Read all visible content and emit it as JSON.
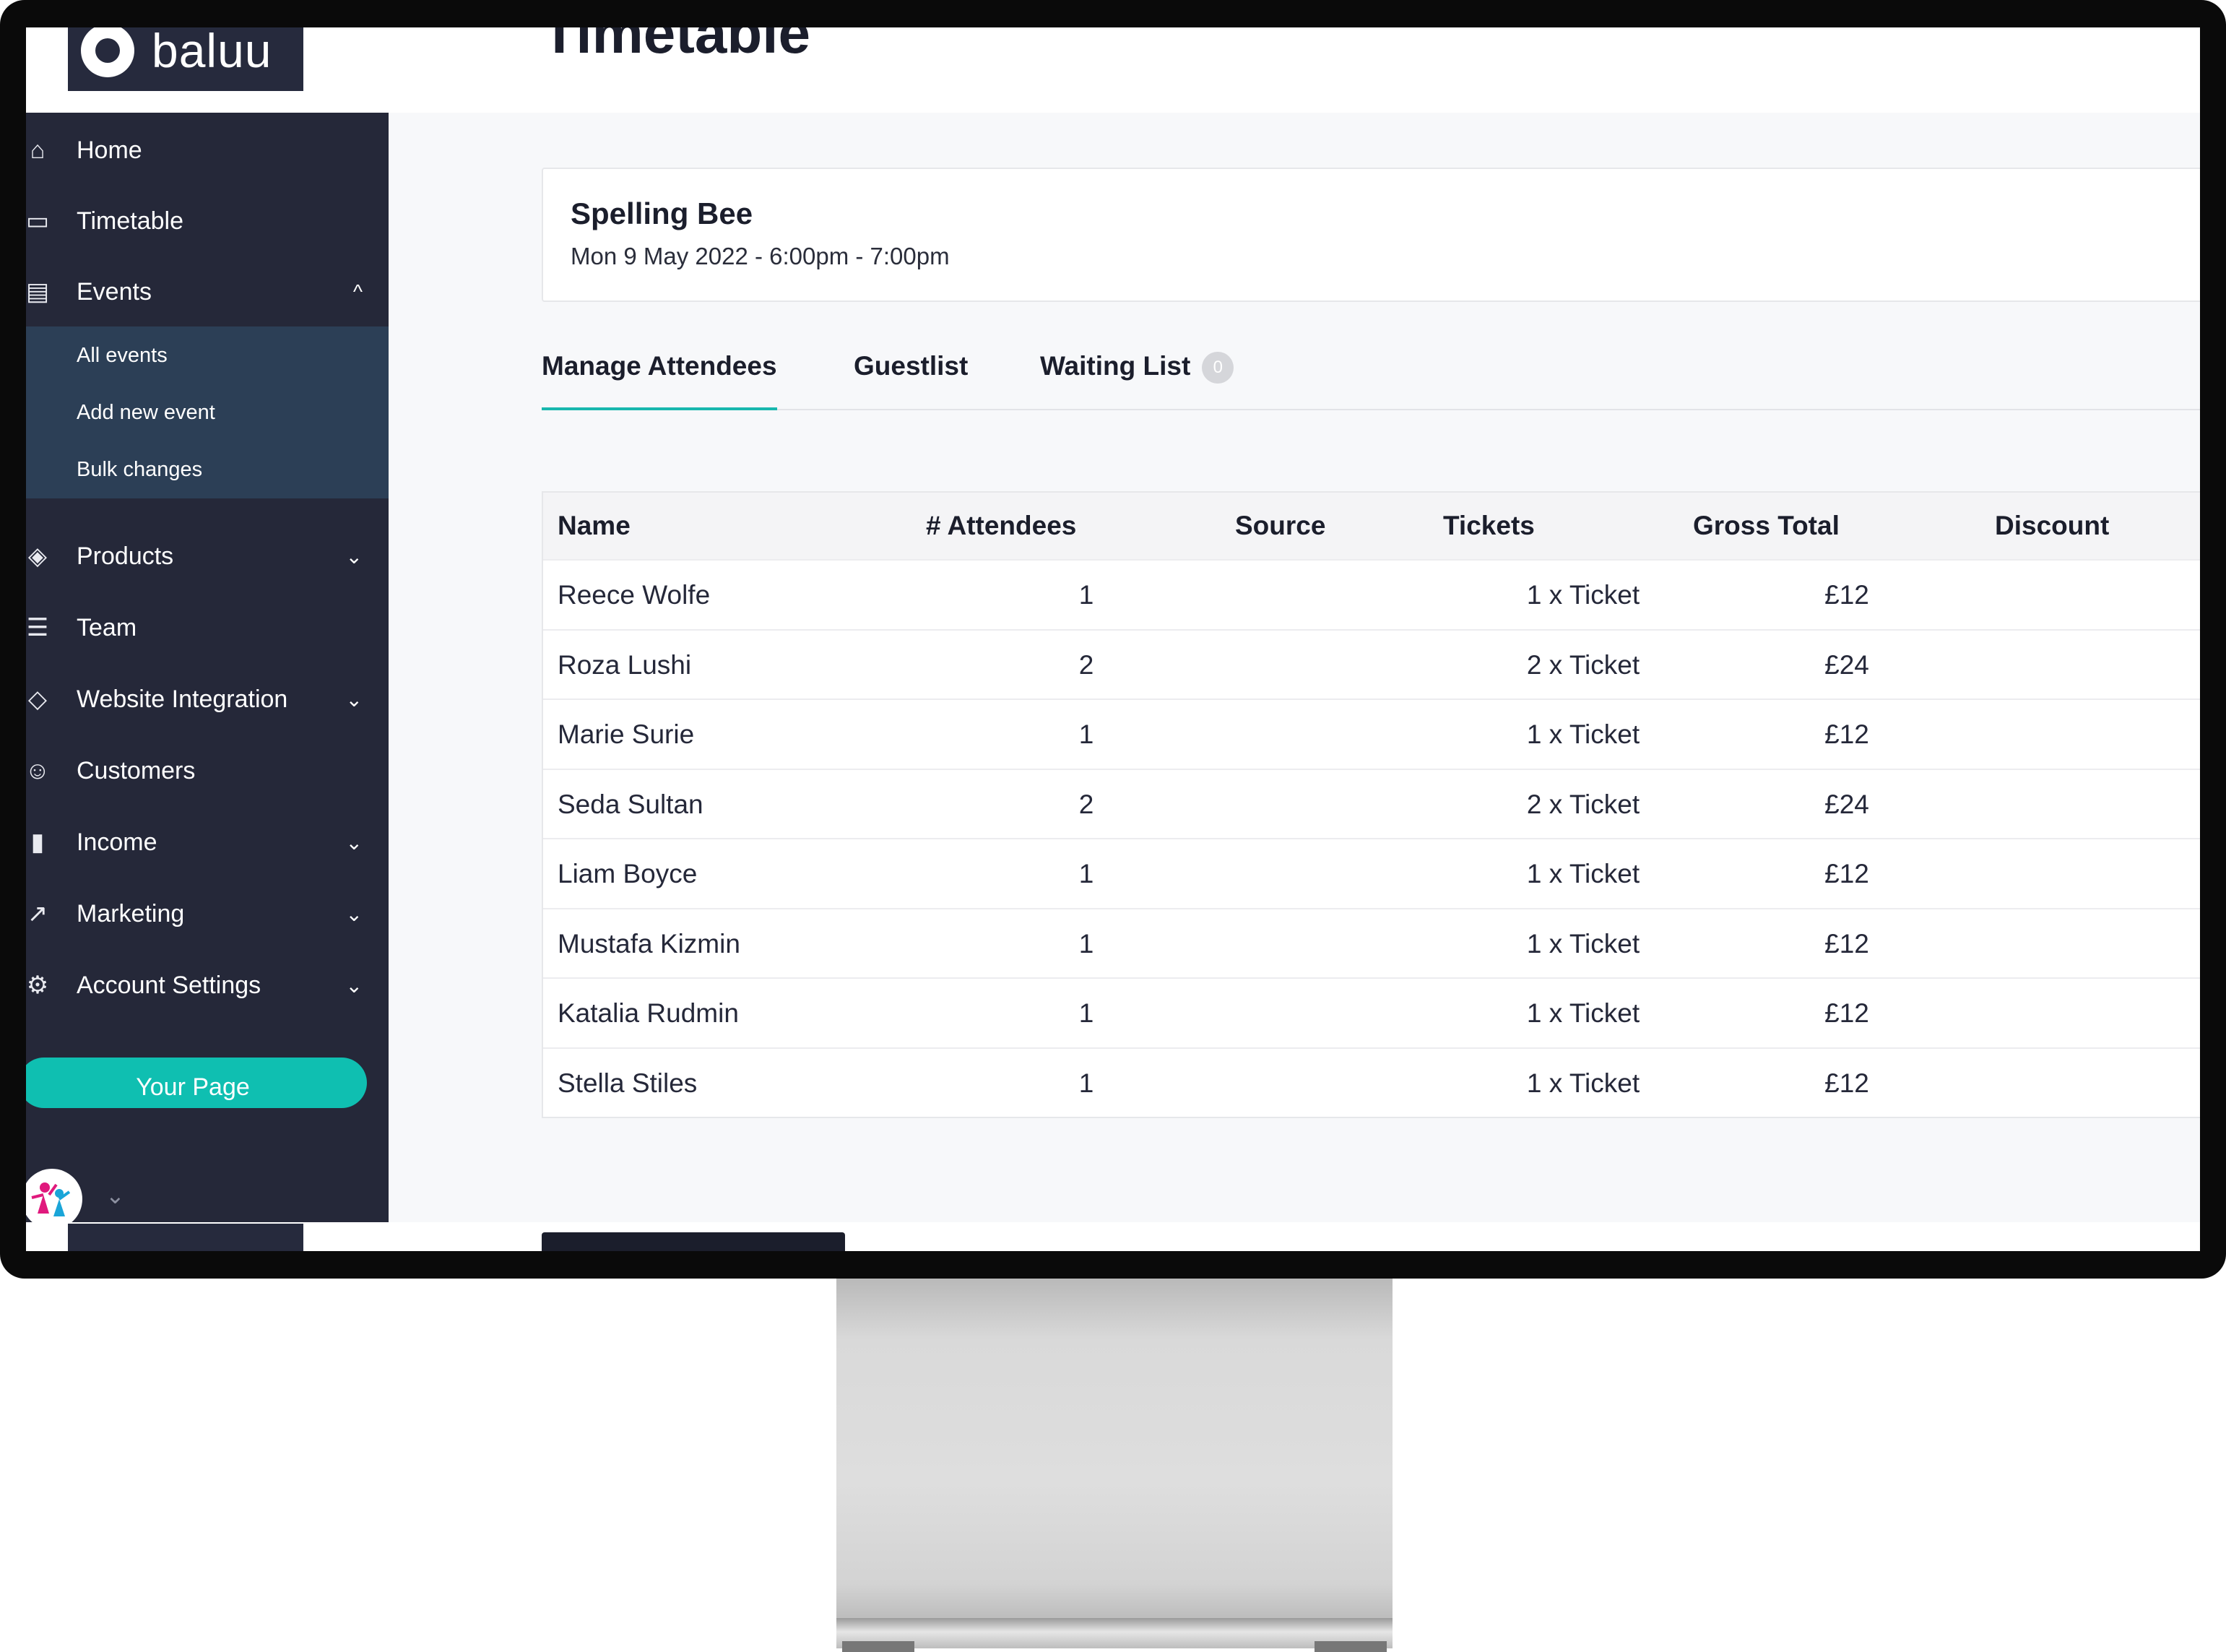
{
  "app": {
    "logo_text": "baluu",
    "page_title": "Timetable"
  },
  "sidebar": {
    "items": [
      {
        "label": "Home",
        "icon": "home-icon"
      },
      {
        "label": "Timetable",
        "icon": "calendar-icon"
      },
      {
        "label": "Events",
        "icon": "document-icon",
        "chevron": "^"
      },
      {
        "label": "Products",
        "icon": "layers-icon",
        "chevron": "⌄"
      },
      {
        "label": "Team",
        "icon": "team-icon"
      },
      {
        "label": "Website Integration",
        "icon": "tag-icon",
        "chevron": "⌄"
      },
      {
        "label": "Customers",
        "icon": "users-icon"
      },
      {
        "label": "Income",
        "icon": "bar-chart-icon",
        "chevron": "⌄"
      },
      {
        "label": "Marketing",
        "icon": "trend-icon",
        "chevron": "⌄"
      },
      {
        "label": "Account Settings",
        "icon": "gear-icon",
        "chevron": "⌄"
      }
    ],
    "events_submenu": [
      "All events",
      "Add new event",
      "Bulk changes"
    ],
    "your_page_label": "Your Page",
    "avatar_chevron": "⌄"
  },
  "event": {
    "name": "Spelling Bee",
    "date": "Mon 9 May 2022 - 6:00pm - 7:00pm"
  },
  "tabs": [
    {
      "label": "Manage Attendees",
      "active": true
    },
    {
      "label": "Guestlist",
      "active": false
    },
    {
      "label": "Waiting List",
      "active": false,
      "badge": "0"
    }
  ],
  "table": {
    "headers": [
      "Name",
      "# Attendees",
      "Source",
      "Tickets",
      "Gross Total",
      "Discount"
    ],
    "rows": [
      {
        "name": "Reece Wolfe",
        "attendees": "1",
        "source": "",
        "tickets": "1 x Ticket",
        "gross": "£12",
        "discount": ""
      },
      {
        "name": "Roza Lushi",
        "attendees": "2",
        "source": "",
        "tickets": "2 x Ticket",
        "gross": "£24",
        "discount": ""
      },
      {
        "name": "Marie Surie",
        "attendees": "1",
        "source": "",
        "tickets": "1 x Ticket",
        "gross": "£12",
        "discount": ""
      },
      {
        "name": "Seda Sultan",
        "attendees": "2",
        "source": "",
        "tickets": "2 x Ticket",
        "gross": "£24",
        "discount": ""
      },
      {
        "name": "Liam Boyce",
        "attendees": "1",
        "source": "",
        "tickets": "1 x Ticket",
        "gross": "£12",
        "discount": ""
      },
      {
        "name": "Mustafa Kizmin",
        "attendees": "1",
        "source": "",
        "tickets": "1 x Ticket",
        "gross": "£12",
        "discount": ""
      },
      {
        "name": "Katalia Rudmin",
        "attendees": "1",
        "source": "",
        "tickets": "1 x Ticket",
        "gross": "£12",
        "discount": ""
      },
      {
        "name": "Stella Stiles",
        "attendees": "1",
        "source": "",
        "tickets": "1 x Ticket",
        "gross": "£12",
        "discount": ""
      }
    ]
  },
  "colors": {
    "sidebar": "#252839",
    "submenu": "#2c3f56",
    "accent": "#0fbfb1",
    "text": "#1b1e2c"
  }
}
